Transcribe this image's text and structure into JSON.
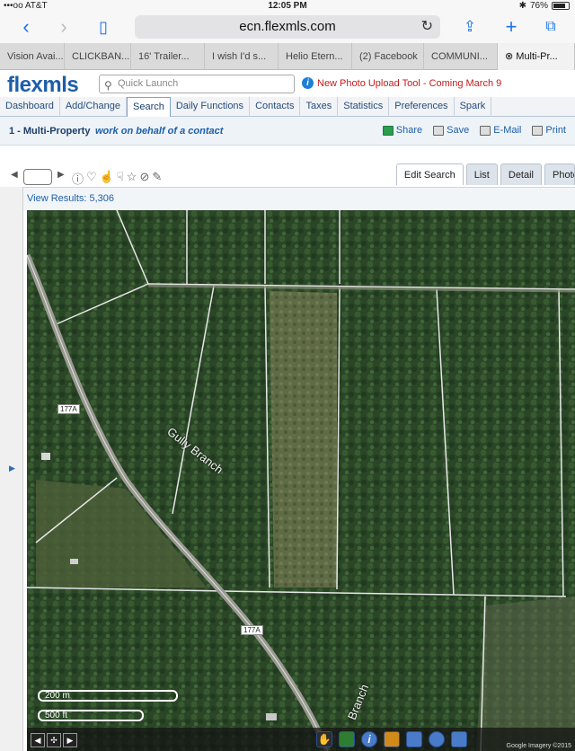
{
  "status": {
    "carrier": "•••oo AT&T",
    "time": "12:05 PM",
    "battery": "76%"
  },
  "browser": {
    "url": "ecn.flexmls.com"
  },
  "tabs": [
    "Vision Avai...",
    "CLICKBAN...",
    "16' Trailer...",
    "I wish I'd s...",
    "Helio Etern...",
    "(2) Facebook",
    "COMMUNI...",
    "Multi-Pr..."
  ],
  "header": {
    "logo": "flexmls",
    "quick_launch_placeholder": "Quick Launch",
    "notice": "New Photo Upload Tool - Coming March 9"
  },
  "menu": [
    "Dashboard",
    "Add/Change",
    "Search",
    "Daily Functions",
    "Contacts",
    "Taxes",
    "Statistics",
    "Preferences",
    "Spark"
  ],
  "menu_active": "Search",
  "subheader": {
    "title": "1 - Multi-Property",
    "contact": "work on behalf of a contact",
    "actions": [
      "Share",
      "Save",
      "E-Mail",
      "Print"
    ]
  },
  "view_tabs": [
    "Edit Search",
    "List",
    "Detail",
    "Photo"
  ],
  "results": "View Results: 5,306",
  "map": {
    "road_label": "177A",
    "place_label": "Gully Branch",
    "place_label_2": "Branch",
    "scale_m": "200 m",
    "scale_ft": "500 ft",
    "copyright": "Google Imagery ©2015"
  },
  "colors": {
    "brand": "#1d5ea8",
    "notice": "#c21c1c",
    "forest": "#2f4a2a"
  }
}
